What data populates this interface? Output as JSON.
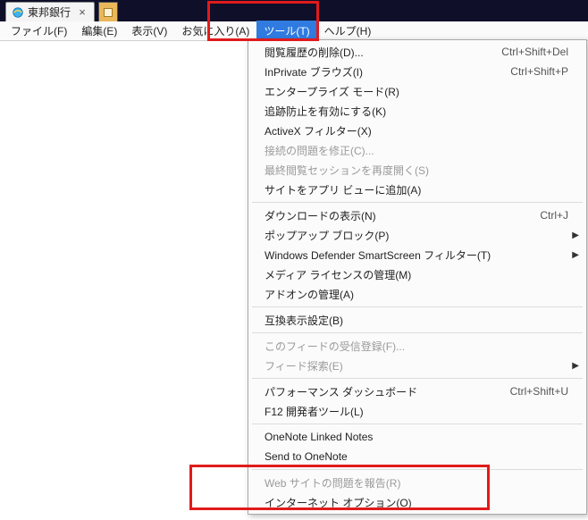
{
  "tab": {
    "title": "東邦銀行",
    "close": "×"
  },
  "menubar": {
    "items": [
      {
        "label": "ファイル(F)"
      },
      {
        "label": "編集(E)"
      },
      {
        "label": "表示(V)"
      },
      {
        "label": "お気に入り(A)"
      },
      {
        "label": "ツール(T)"
      },
      {
        "label": "ヘルプ(H)"
      }
    ],
    "activeIndex": 4
  },
  "dropdown": [
    {
      "type": "item",
      "label": "閲覧履歴の削除(D)...",
      "shortcut": "Ctrl+Shift+Del"
    },
    {
      "type": "item",
      "label": "InPrivate ブラウズ(I)",
      "shortcut": "Ctrl+Shift+P"
    },
    {
      "type": "item",
      "label": "エンタープライズ モード(R)"
    },
    {
      "type": "item",
      "label": "追跡防止を有効にする(K)"
    },
    {
      "type": "item",
      "label": "ActiveX フィルター(X)"
    },
    {
      "type": "item",
      "label": "接続の問題を修正(C)...",
      "disabled": true
    },
    {
      "type": "item",
      "label": "最終閲覧セッションを再度開く(S)",
      "disabled": true
    },
    {
      "type": "item",
      "label": "サイトをアプリ ビューに追加(A)"
    },
    {
      "type": "sep"
    },
    {
      "type": "item",
      "label": "ダウンロードの表示(N)",
      "shortcut": "Ctrl+J"
    },
    {
      "type": "item",
      "label": "ポップアップ ブロック(P)",
      "submenu": true
    },
    {
      "type": "item",
      "label": "Windows Defender SmartScreen フィルター(T)",
      "submenu": true
    },
    {
      "type": "item",
      "label": "メディア ライセンスの管理(M)"
    },
    {
      "type": "item",
      "label": "アドオンの管理(A)"
    },
    {
      "type": "sep"
    },
    {
      "type": "item",
      "label": "互換表示設定(B)"
    },
    {
      "type": "sep"
    },
    {
      "type": "item",
      "label": "このフィードの受信登録(F)...",
      "disabled": true
    },
    {
      "type": "item",
      "label": "フィード探索(E)",
      "disabled": true,
      "submenu": true
    },
    {
      "type": "sep"
    },
    {
      "type": "item",
      "label": "パフォーマンス ダッシュボード",
      "shortcut": "Ctrl+Shift+U"
    },
    {
      "type": "item",
      "label": "F12 開発者ツール(L)"
    },
    {
      "type": "sep"
    },
    {
      "type": "item",
      "label": "OneNote Linked Notes"
    },
    {
      "type": "item",
      "label": "Send to OneNote"
    },
    {
      "type": "sep"
    },
    {
      "type": "item",
      "label": "Web サイトの問題を報告(R)",
      "disabled": true
    },
    {
      "type": "item",
      "label": "インターネット オプション(O)"
    }
  ]
}
